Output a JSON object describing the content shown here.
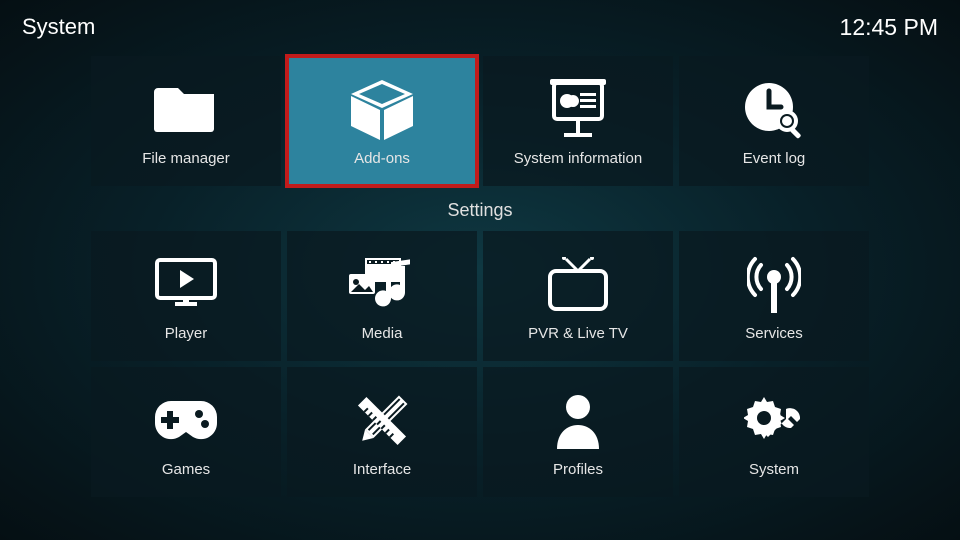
{
  "header": {
    "title": "System",
    "clock": "12:45 PM"
  },
  "top_tiles": [
    {
      "id": "filemanager",
      "label": "File manager",
      "icon": "folder-icon",
      "selected": false
    },
    {
      "id": "addons",
      "label": "Add-ons",
      "icon": "box-icon",
      "selected": true
    },
    {
      "id": "sysinfo",
      "label": "System information",
      "icon": "chart-board-icon",
      "selected": false
    },
    {
      "id": "eventlog",
      "label": "Event log",
      "icon": "clock-search-icon",
      "selected": false
    }
  ],
  "section_title": "Settings",
  "settings_tiles": [
    {
      "id": "player",
      "label": "Player",
      "icon": "monitor-play-icon"
    },
    {
      "id": "media",
      "label": "Media",
      "icon": "media-icon"
    },
    {
      "id": "pvr",
      "label": "PVR & Live TV",
      "icon": "tv-icon"
    },
    {
      "id": "services",
      "label": "Services",
      "icon": "antenna-icon"
    },
    {
      "id": "games",
      "label": "Games",
      "icon": "gamepad-icon"
    },
    {
      "id": "interface",
      "label": "Interface",
      "icon": "pencil-ruler-icon"
    },
    {
      "id": "profiles",
      "label": "Profiles",
      "icon": "person-icon"
    },
    {
      "id": "system",
      "label": "System",
      "icon": "gear-wrench-icon"
    }
  ]
}
